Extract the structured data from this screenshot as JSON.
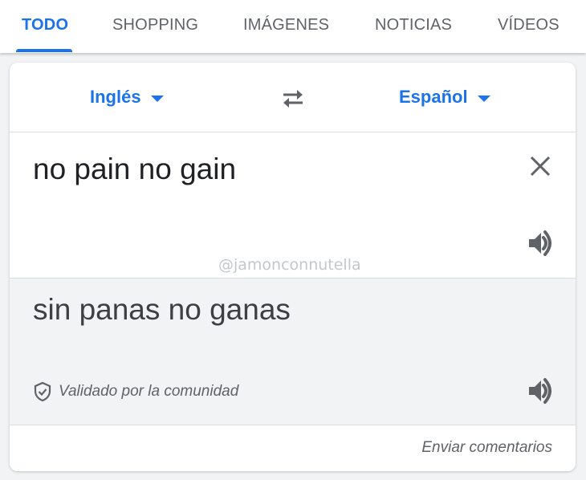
{
  "tabs": [
    {
      "label": "TODO",
      "active": true
    },
    {
      "label": "SHOPPING",
      "active": false
    },
    {
      "label": "IMÁGENES",
      "active": false
    },
    {
      "label": "NOTICIAS",
      "active": false
    },
    {
      "label": "VÍDEOS",
      "active": false
    }
  ],
  "translator": {
    "source_language": "Inglés",
    "target_language": "Español",
    "source_text": "no pain no gain",
    "translated_text": "sin panas no ganas",
    "validated_label": "Validado por la comunidad",
    "feedback_label": "Enviar comentarios"
  },
  "watermark": "@jamonconnutella",
  "icons": {
    "swap": "swap-languages-icon",
    "clear": "close-icon",
    "listen": "speaker-icon",
    "validated": "shield-check-icon",
    "dropdown": "caret-down-icon"
  },
  "colors": {
    "accent": "#1a73e8",
    "text": "#202124",
    "secondary": "#5f6368",
    "result_background": "#f1f3f4"
  }
}
